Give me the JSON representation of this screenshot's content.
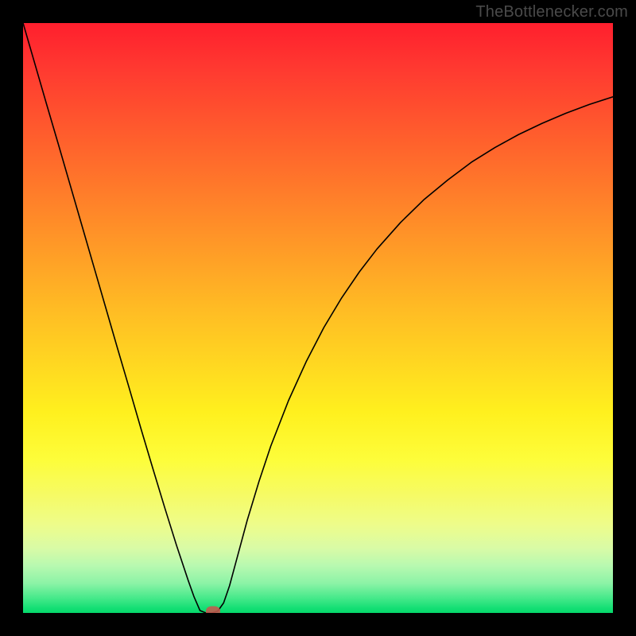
{
  "watermark": {
    "text": "TheBottlenecker.com"
  },
  "chart_data": {
    "type": "line",
    "title": "",
    "xlabel": "",
    "ylabel": "",
    "xlim": [
      0,
      1
    ],
    "ylim": [
      0,
      1
    ],
    "series": [
      {
        "name": "bottleneck-curve",
        "x": [
          0.0,
          0.02,
          0.04,
          0.06,
          0.08,
          0.1,
          0.12,
          0.14,
          0.16,
          0.18,
          0.2,
          0.22,
          0.24,
          0.26,
          0.28,
          0.29,
          0.3,
          0.31,
          0.32,
          0.33,
          0.34,
          0.35,
          0.36,
          0.38,
          0.4,
          0.42,
          0.45,
          0.48,
          0.51,
          0.54,
          0.57,
          0.6,
          0.64,
          0.68,
          0.72,
          0.76,
          0.8,
          0.84,
          0.88,
          0.92,
          0.96,
          1.0
        ],
        "values": [
          1.0,
          0.931,
          0.862,
          0.794,
          0.725,
          0.656,
          0.587,
          0.518,
          0.449,
          0.381,
          0.312,
          0.245,
          0.179,
          0.115,
          0.055,
          0.027,
          0.004,
          0.0,
          0.0,
          0.003,
          0.017,
          0.046,
          0.083,
          0.157,
          0.223,
          0.283,
          0.36,
          0.426,
          0.484,
          0.534,
          0.578,
          0.617,
          0.662,
          0.701,
          0.734,
          0.764,
          0.789,
          0.811,
          0.83,
          0.847,
          0.862,
          0.875
        ]
      }
    ],
    "marker": {
      "x": 0.322,
      "y": 0.003
    },
    "gradient_stops": [
      {
        "pos": 0.0,
        "color": "#ff1f2e"
      },
      {
        "pos": 0.08,
        "color": "#ff3a30"
      },
      {
        "pos": 0.18,
        "color": "#ff5a2d"
      },
      {
        "pos": 0.28,
        "color": "#ff7a2a"
      },
      {
        "pos": 0.38,
        "color": "#ff9a27"
      },
      {
        "pos": 0.48,
        "color": "#ffba24"
      },
      {
        "pos": 0.58,
        "color": "#ffd821"
      },
      {
        "pos": 0.66,
        "color": "#fff01e"
      },
      {
        "pos": 0.74,
        "color": "#fdfd3a"
      },
      {
        "pos": 0.8,
        "color": "#f6fb65"
      },
      {
        "pos": 0.85,
        "color": "#eefc8a"
      },
      {
        "pos": 0.89,
        "color": "#d9fba6"
      },
      {
        "pos": 0.92,
        "color": "#b8f9b0"
      },
      {
        "pos": 0.95,
        "color": "#8bf3a6"
      },
      {
        "pos": 0.975,
        "color": "#45e98a"
      },
      {
        "pos": 0.992,
        "color": "#14df74"
      },
      {
        "pos": 1.0,
        "color": "#05d96b"
      }
    ]
  }
}
